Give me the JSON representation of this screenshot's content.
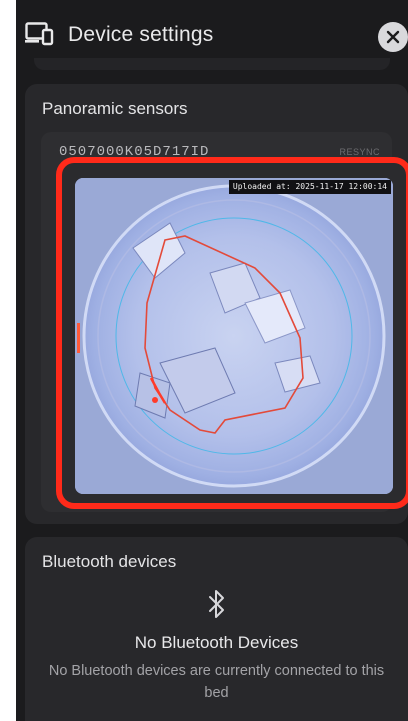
{
  "header": {
    "title": "Device settings",
    "icon": "devices-icon",
    "close_icon": "close-icon"
  },
  "panoramic": {
    "title": "Panoramic sensors",
    "sensor_id": "0507000K05D717ID",
    "sensor_status": "RESYNC",
    "upload_stamp": "Uploaded at: 2025-11-17 12:00:14",
    "highlight_color": "#ff2a1a"
  },
  "bluetooth": {
    "title": "Bluetooth devices",
    "icon": "bluetooth-icon",
    "empty_title": "No Bluetooth Devices",
    "empty_description": "No Bluetooth devices are currently connected to this bed"
  },
  "colors": {
    "background": "#1b1b1d",
    "card": "#28282b",
    "accent_red": "#ff2a1a"
  }
}
